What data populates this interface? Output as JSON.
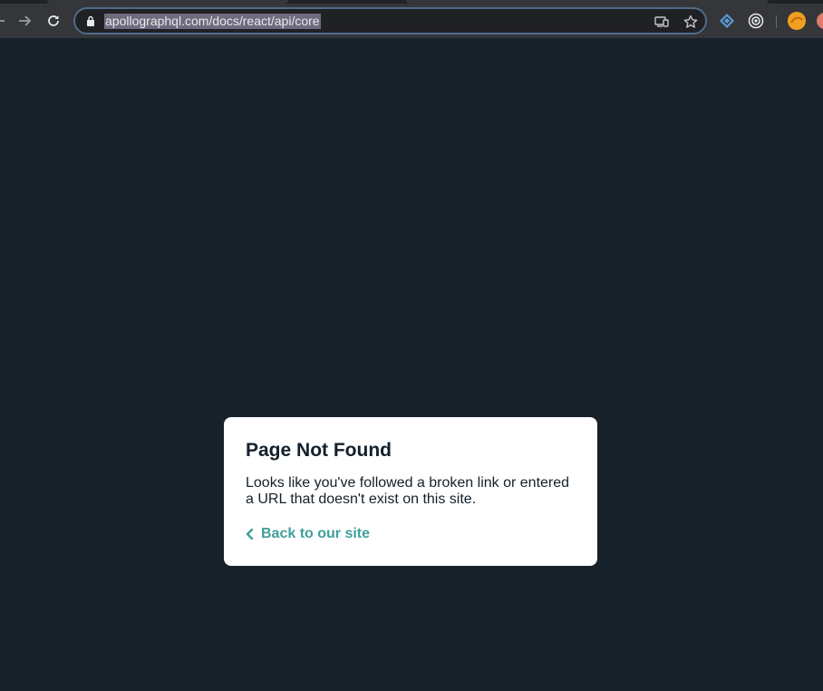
{
  "browser": {
    "url": "apollographql.com/docs/react/api/core",
    "icons": {
      "back": "back-arrow-icon",
      "forward": "forward-arrow-icon",
      "reload": "reload-icon",
      "lock": "lock-icon",
      "cast": "cast-icon",
      "bookmark": "star-icon"
    },
    "extensions": [
      "graphql-extension-icon",
      "target-extension-icon",
      "orange-avatar-extension-icon",
      "profile-icon"
    ]
  },
  "page": {
    "title": "Page Not Found",
    "message": "Looks like you've followed a broken link or entered a URL that doesn't exist on this site.",
    "back_link": "Back to our site"
  },
  "colors": {
    "background": "#16212a",
    "card": "#ffffff",
    "link": "#3f9f9a",
    "text": "#14202b"
  }
}
